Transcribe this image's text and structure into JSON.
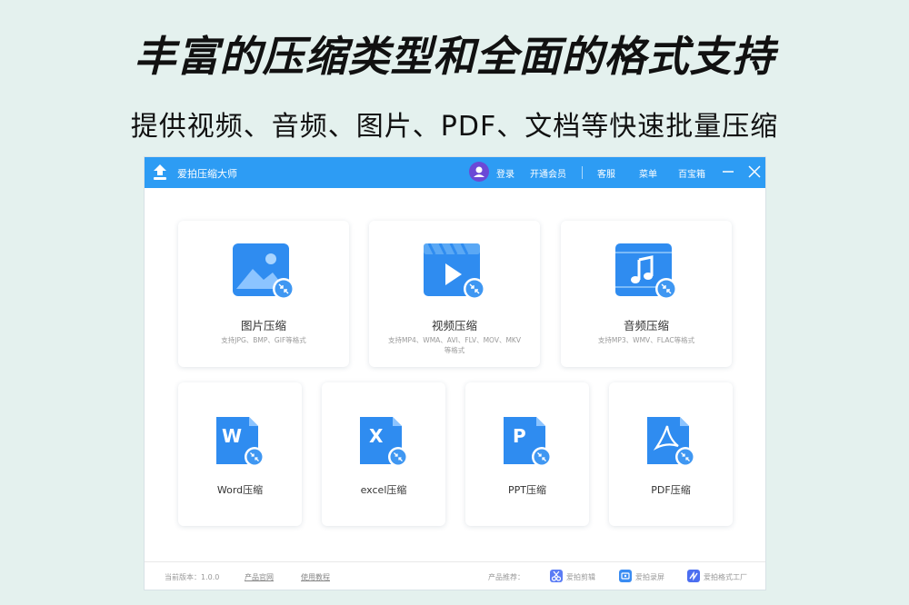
{
  "banner": {
    "headline": "丰富的压缩类型和全面的格式支持",
    "subline": "提供视频、音频、图片、PDF、文档等快速批量压缩"
  },
  "titlebar": {
    "app_title": "爱拍压缩大师",
    "login": "登录",
    "vip": "开通会员",
    "service": "客服",
    "menu": "菜单",
    "toolbox": "百宝箱"
  },
  "cards_top": [
    {
      "label": "图片压缩",
      "desc": "支持JPG、BMP、GIF等格式",
      "icon": "image-icon"
    },
    {
      "label": "视频压缩",
      "desc": "支持MP4、WMA、AVI、FLV、MOV、MKV等格式",
      "icon": "video-icon"
    },
    {
      "label": "音频压缩",
      "desc": "支持MP3、WMV、FLAC等格式",
      "icon": "music-icon"
    }
  ],
  "cards_bottom": [
    {
      "label": "Word压缩",
      "icon": "word-icon"
    },
    {
      "label": "excel压缩",
      "icon": "excel-icon"
    },
    {
      "label": "PPT压缩",
      "icon": "ppt-icon"
    },
    {
      "label": "PDF压缩",
      "icon": "pdf-icon"
    }
  ],
  "footer": {
    "version": "当前版本：1.0.0",
    "website": "产品官网",
    "tutorial": "使用教程",
    "recommend": "产品推荐：",
    "products": [
      "爱拍剪辑",
      "爱拍录屏",
      "爱拍格式工厂"
    ]
  },
  "colors": {
    "titlebar": "#2d9cf4",
    "icon_blue": "#2f8cf0",
    "background": "#e4f1ee"
  }
}
